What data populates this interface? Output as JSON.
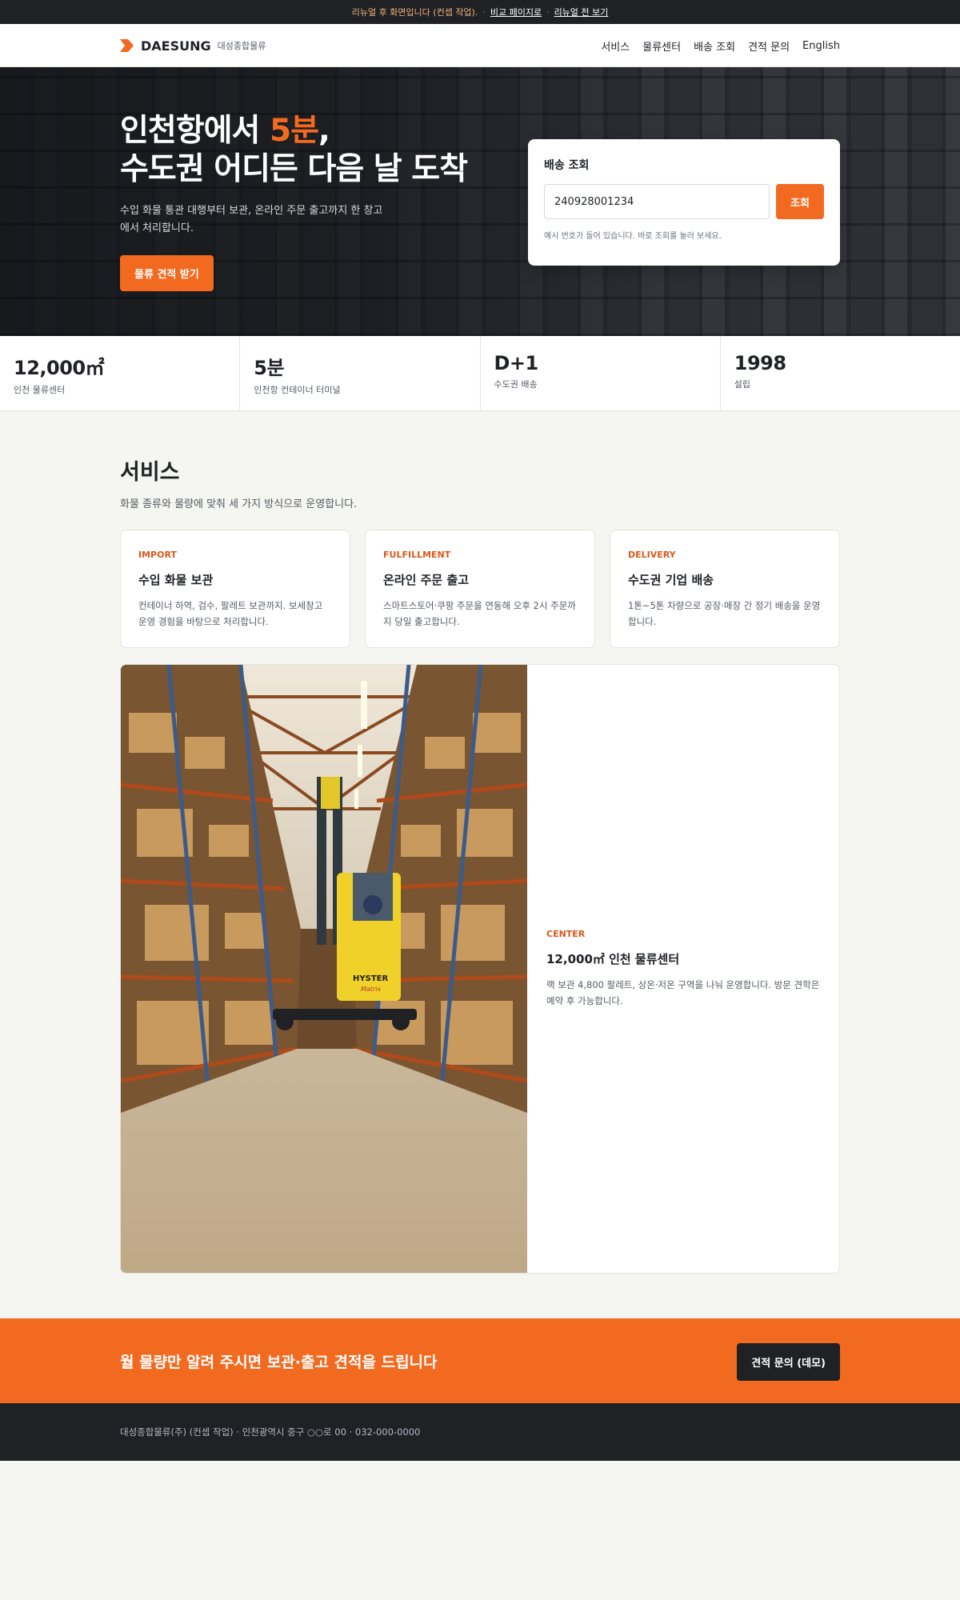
{
  "topbar": {
    "notice": "리뉴얼 후 화면입니다 (컨셉 작업).",
    "sep1": "·",
    "compare_link": "비교 페이지로",
    "sep2": "·",
    "before_link": "리뉴얼 전 보기"
  },
  "header": {
    "logo_name": "DAESUNG",
    "logo_sub": "대성종합물류",
    "brand_color": "#f26a1f",
    "nav": [
      "서비스",
      "물류센터",
      "배송 조회",
      "견적 문의",
      "English"
    ]
  },
  "hero": {
    "title_line1_prefix": "인천항에서 ",
    "title_line1_accent": "5분",
    "title_line1_suffix": ",",
    "title_line2": "수도권 어디든 다음 날 도착",
    "description": "수입 화물 통관 대행부터 보관, 온라인 주문 출고까지 한 창고에서 처리합니다.",
    "cta_label": "물류 견적 받기"
  },
  "tracking": {
    "title": "배송 조회",
    "input_value": "240928001234",
    "button_label": "조회",
    "hint": "예시 번호가 들어 있습니다. 바로 조회를 눌러 보세요."
  },
  "stats": [
    {
      "value": "12,000㎡",
      "label": "인천 물류센터"
    },
    {
      "value": "5분",
      "label": "인천항 컨테이너 터미널"
    },
    {
      "value": "D+1",
      "label": "수도권 배송"
    },
    {
      "value": "1998",
      "label": "설립"
    }
  ],
  "services": {
    "title": "서비스",
    "description": "화물 종류와 물량에 맞춰 세 가지 방식으로 운영합니다.",
    "cards": [
      {
        "tag": "IMPORT",
        "title": "수입 화물 보관",
        "desc": "컨테이너 하역, 검수, 팔레트 보관까지. 보세창고 운영 경험을 바탕으로 처리합니다."
      },
      {
        "tag": "FULFILLMENT",
        "title": "온라인 주문 출고",
        "desc": "스마트스토어·쿠팡 주문을 연동해 오후 2시 주문까지 당일 출고합니다."
      },
      {
        "tag": "DELIVERY",
        "title": "수도권 기업 배송",
        "desc": "1톤~5톤 차량으로 공장·매장 간 정기 배송을 운영합니다."
      }
    ]
  },
  "center": {
    "tag": "CENTER",
    "title": "12,000㎡ 인천 물류센터",
    "desc": "랙 보관 4,800 팔레트, 상온·저온 구역을 나눠 운영합니다. 방문 견학은 예약 후 가능합니다.",
    "forklift_brand": "HYSTER",
    "forklift_model": "Matrix"
  },
  "cta": {
    "text": "월 물량만 알려 주시면 보관·출고 견적을 드립니다",
    "button_label": "견적 문의 (데모)"
  },
  "footer": {
    "text": "대성종합물류(주) (컨셉 작업) · 인천광역시 중구 ○○로 00 · 032-000-0000"
  }
}
